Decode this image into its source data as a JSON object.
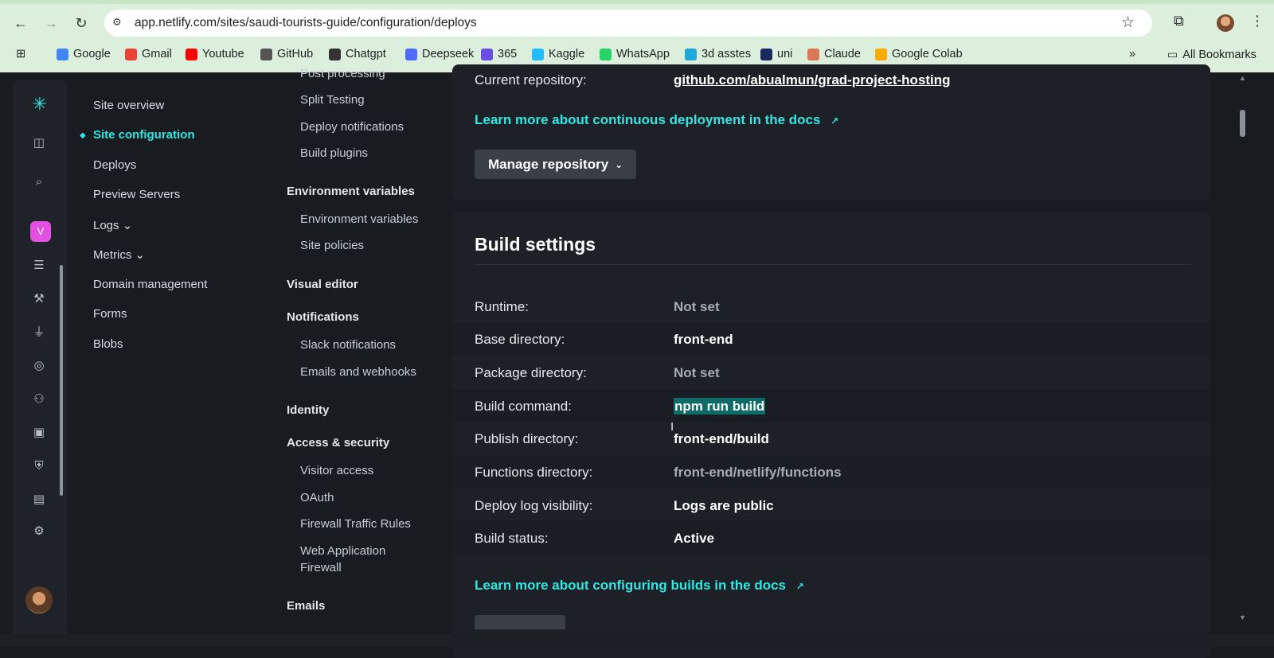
{
  "browser": {
    "url": "app.netlify.com/sites/saudi-tourists-guide/configuration/deploys",
    "bookmarks": [
      {
        "label": "Google",
        "icon": "google-icon",
        "color": "#4285f4"
      },
      {
        "label": "Gmail",
        "icon": "gmail-icon",
        "color": "#ea4335"
      },
      {
        "label": "Youtube",
        "icon": "youtube-icon",
        "color": "#ff0000"
      },
      {
        "label": "GitHub",
        "icon": "github-icon",
        "color": "#555555"
      },
      {
        "label": "Chatgpt",
        "icon": "chatgpt-icon",
        "color": "#333333"
      },
      {
        "label": "Deepseek",
        "icon": "deepseek-icon",
        "color": "#4d6bfe"
      },
      {
        "label": "365",
        "icon": "office365-icon",
        "color": "#6b4ee6"
      },
      {
        "label": "Kaggle",
        "icon": "kaggle-icon",
        "color": "#20beff"
      },
      {
        "label": "WhatsApp",
        "icon": "whatsapp-icon",
        "color": "#25d366"
      },
      {
        "label": "3d asstes",
        "icon": "sketchfab-icon",
        "color": "#1caad9"
      },
      {
        "label": "uni",
        "icon": "uni-icon",
        "color": "#1a2a5e"
      },
      {
        "label": "Claude",
        "icon": "claude-icon",
        "color": "#d97757"
      },
      {
        "label": "Google Colab",
        "icon": "colab-icon",
        "color": "#f9ab00"
      }
    ],
    "all_bookmarks": "All Bookmarks"
  },
  "rail": {
    "team_initial": "V"
  },
  "nav_primary": {
    "items": [
      {
        "label": "Site overview"
      },
      {
        "label": "Site configuration",
        "active": true
      },
      {
        "label": "Deploys"
      },
      {
        "label": "Preview Servers"
      },
      {
        "label": "Logs ⌄"
      },
      {
        "label": "Metrics ⌄"
      },
      {
        "label": "Domain management"
      },
      {
        "label": "Forms"
      },
      {
        "label": "Blobs"
      }
    ]
  },
  "nav_secondary": {
    "post_processing": "Post processing",
    "split_testing": "Split Testing",
    "deploy_notifications": "Deploy notifications",
    "build_plugins": "Build plugins",
    "env_head": "Environment variables",
    "env_vars": "Environment variables",
    "site_policies": "Site policies",
    "visual_editor": "Visual editor",
    "notifications_head": "Notifications",
    "slack": "Slack notifications",
    "emails_webhooks": "Emails and webhooks",
    "identity": "Identity",
    "access_head": "Access & security",
    "visitor_access": "Visitor access",
    "oauth": "OAuth",
    "firewall": "Firewall Traffic Rules",
    "waf_line1": "Web Application",
    "waf_line2": "Firewall",
    "emails": "Emails"
  },
  "repo_card": {
    "current_repo_label": "Current repository:",
    "current_repo_value": "github.com/abualmun/grad-project-hosting",
    "learn_link": "Learn more about continuous deployment in the docs",
    "manage_button": "Manage repository"
  },
  "build_settings": {
    "title": "Build settings",
    "runtime_label": "Runtime:",
    "runtime_value": "Not set",
    "base_label": "Base directory:",
    "base_value": "front-end",
    "package_label": "Package directory:",
    "package_value": "Not set",
    "build_cmd_label": "Build command:",
    "build_cmd_value": "npm run build",
    "publish_label": "Publish directory:",
    "publish_value": "front-end/build",
    "functions_label": "Functions directory:",
    "functions_value": "front-end/netlify/functions",
    "log_label": "Deploy log visibility:",
    "log_value": "Logs are public",
    "status_label": "Build status:",
    "status_value": "Active",
    "learn_link": "Learn more about configuring builds in the docs"
  },
  "colors": {
    "accent": "#32e6e2",
    "background": "#181b20",
    "card": "#1d2127"
  }
}
